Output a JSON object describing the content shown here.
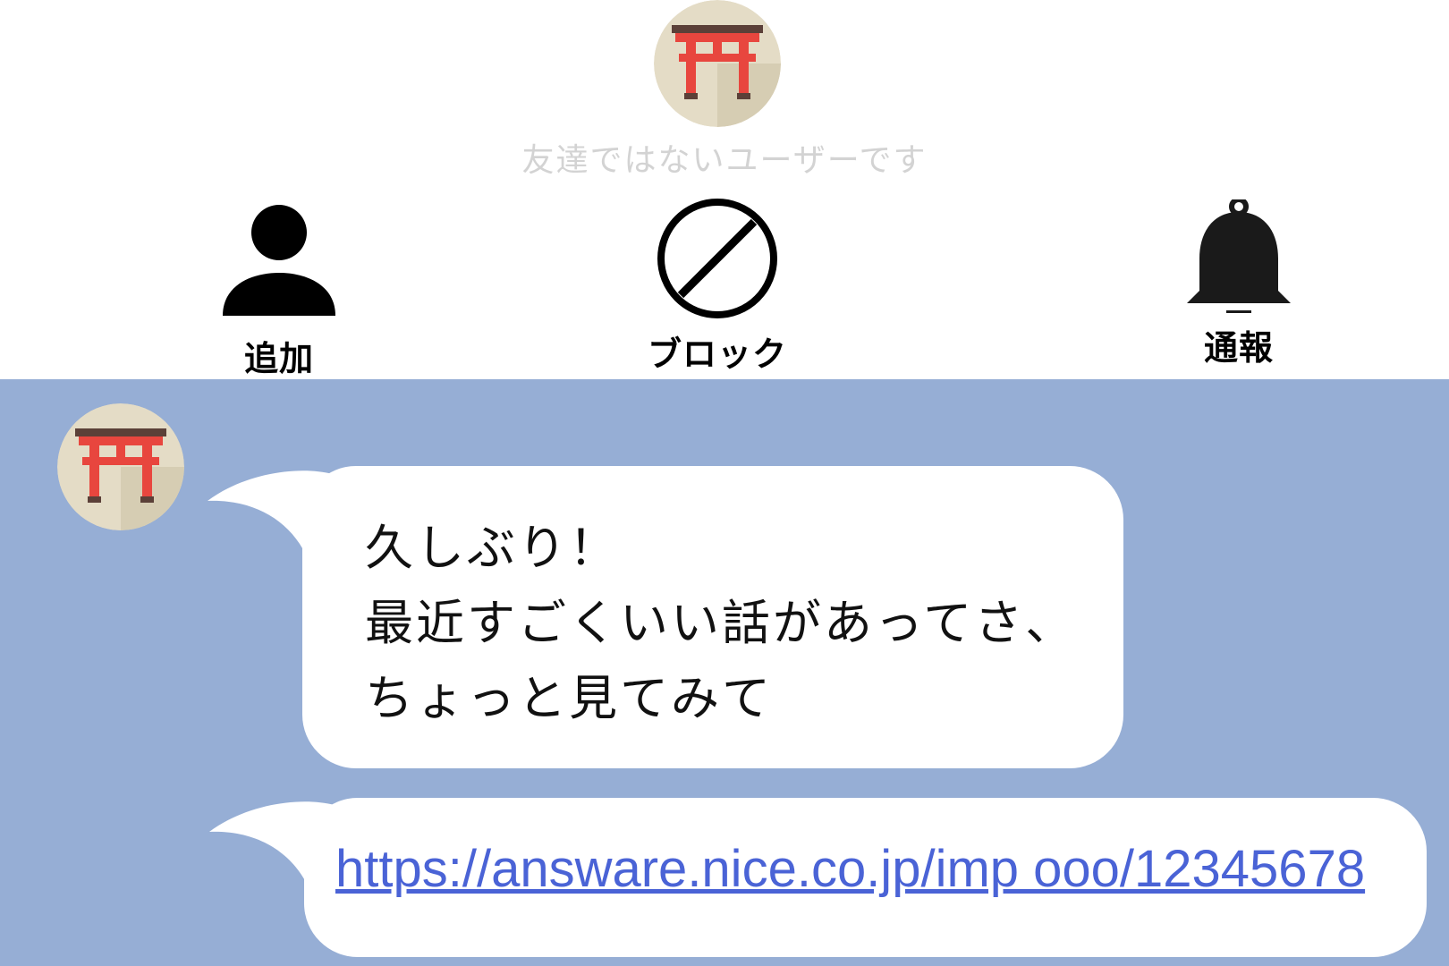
{
  "profile": {
    "status_text": "友達ではないユーザーです"
  },
  "actions": {
    "add_label": "追加",
    "block_label": "ブロック",
    "report_label": "通報"
  },
  "messages": [
    {
      "text": "久しぶり！\n最近すごくいい話があってさ、\nちょっと見てみて"
    },
    {
      "link": "https://answare.nice.co.jp/imp ooo/12345678"
    }
  ],
  "colors": {
    "chat_background": "#96aed5",
    "link": "#4a63d6",
    "status_text": "#d3d3d3",
    "torii_red": "#e8463e",
    "avatar_bg": "#e4dcc6"
  },
  "icons": {
    "avatar": "torii-gate-icon",
    "add": "person-icon",
    "block": "prohibited-icon",
    "report": "bell-icon"
  }
}
